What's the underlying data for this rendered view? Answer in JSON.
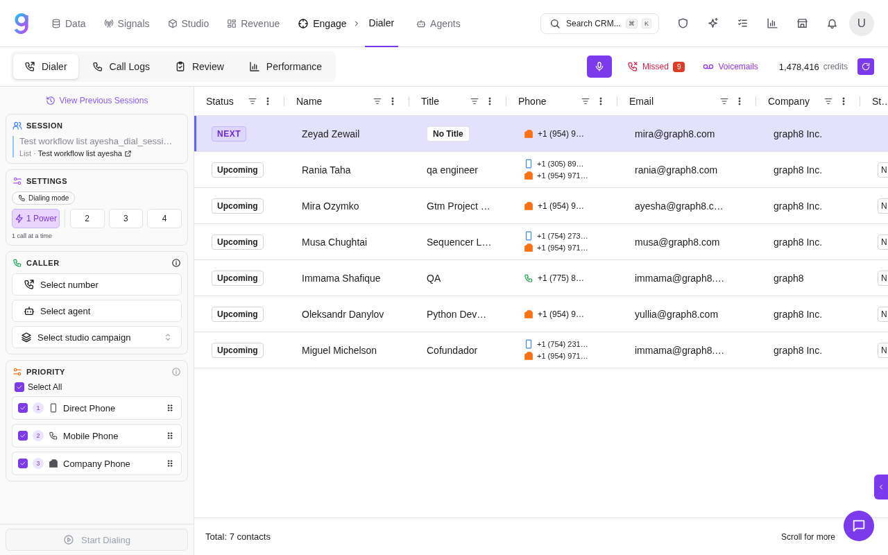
{
  "nav": {
    "items": [
      {
        "label": "Data",
        "selected": false
      },
      {
        "label": "Signals",
        "selected": false
      },
      {
        "label": "Studio",
        "selected": false
      },
      {
        "label": "Revenue",
        "selected": false
      },
      {
        "label": "Engage",
        "sub": "Dialer",
        "selected": true
      },
      {
        "label": "Agents",
        "selected": false
      }
    ]
  },
  "search": {
    "placeholder": "Search CRM...",
    "keys": [
      "⌘",
      "K"
    ]
  },
  "avatar": "U",
  "tabs": [
    {
      "label": "Dialer",
      "selected": true
    },
    {
      "label": "Call Logs",
      "selected": false
    },
    {
      "label": "Review",
      "selected": false
    },
    {
      "label": "Performance",
      "selected": false
    }
  ],
  "missed": {
    "label": "Missed",
    "count": "9"
  },
  "voicemails": "Voicemails",
  "credits": {
    "amount": "1,478,416",
    "unit": "credits"
  },
  "sidebar": {
    "history_link": "View Previous Sessions",
    "session": {
      "heading": "SESSION",
      "name": "Test workflow list ayesha_dial_sessi…",
      "list_label": "List ·",
      "list_name": "Test workflow list ayesha"
    },
    "settings": {
      "heading": "SETTINGS",
      "dialing_mode": "Dialing mode",
      "modes": [
        {
          "label": "1 Power",
          "selected": true
        },
        {
          "label": "2",
          "selected": false
        },
        {
          "label": "3",
          "selected": false
        },
        {
          "label": "4",
          "selected": false
        }
      ],
      "hint": "1 call at a time"
    },
    "caller": {
      "heading": "CALLER",
      "fields": [
        {
          "kind": "number",
          "label": "Select number"
        },
        {
          "kind": "agent",
          "label": "Select agent"
        },
        {
          "kind": "campaign",
          "label": "Select studio campaign"
        }
      ]
    },
    "priority": {
      "heading": "PRIORITY",
      "select_all": {
        "label": "Select All",
        "checked": true
      },
      "items": [
        {
          "rank": "1",
          "kind": "mobile",
          "label": "Direct Phone",
          "checked": true
        },
        {
          "rank": "2",
          "kind": "phone",
          "label": "Mobile Phone",
          "checked": true
        },
        {
          "rank": "3",
          "kind": "company",
          "label": "Company Phone",
          "checked": true
        }
      ]
    },
    "start_button": {
      "label": "Start Dialing",
      "disabled": true
    }
  },
  "table": {
    "columns": [
      "Status",
      "Name",
      "Title",
      "Phone",
      "Email",
      "Company",
      "St…"
    ],
    "rows": [
      {
        "selected": true,
        "status": {
          "label": "NEXT",
          "kind": "next"
        },
        "name": "Zeyad Zewail",
        "title": "No Title",
        "title_missing": true,
        "phones": [
          {
            "kind": "company",
            "number": "+1 (954) 9…"
          }
        ],
        "email": "mira@graph8.com",
        "company": "graph8 Inc."
      },
      {
        "selected": false,
        "status": {
          "label": "Upcoming",
          "kind": "upcoming"
        },
        "name": "Rania Taha",
        "title": "qa engineer",
        "title_missing": false,
        "phones": [
          {
            "kind": "mobile",
            "number": "+1 (305) 89…"
          },
          {
            "kind": "company",
            "number": "+1 (954) 971…"
          }
        ],
        "email": "rania@graph8.com",
        "company": "graph8 Inc.",
        "column_7": "N"
      },
      {
        "selected": false,
        "status": {
          "label": "Upcoming",
          "kind": "upcoming"
        },
        "name": "Mira Ozymko",
        "title": "Gtm Project …",
        "title_missing": false,
        "phones": [
          {
            "kind": "company",
            "number": "+1 (954) 9…"
          }
        ],
        "email": "ayesha@graph8.c…",
        "company": "graph8 Inc.",
        "column_7": "N"
      },
      {
        "selected": false,
        "status": {
          "label": "Upcoming",
          "kind": "upcoming"
        },
        "name": "Musa Chughtai",
        "title": "Sequencer L…",
        "title_missing": false,
        "phones": [
          {
            "kind": "mobile",
            "number": "+1 (754) 273…"
          },
          {
            "kind": "company",
            "number": "+1 (954) 971…"
          }
        ],
        "email": "musa@graph8.com",
        "company": "graph8 Inc.",
        "column_7": "N"
      },
      {
        "selected": false,
        "status": {
          "label": "Upcoming",
          "kind": "upcoming"
        },
        "name": "Immama Shafique",
        "title": "QA",
        "title_missing": false,
        "phones": [
          {
            "kind": "phone",
            "number": "+1 (775) 8…"
          }
        ],
        "email": "immama@graph8.…",
        "company": "graph8",
        "column_7": "N"
      },
      {
        "selected": false,
        "status": {
          "label": "Upcoming",
          "kind": "upcoming"
        },
        "name": "Oleksandr Danylov",
        "title": "Python Dev…",
        "title_missing": false,
        "phones": [
          {
            "kind": "company",
            "number": "+1 (954) 9…"
          }
        ],
        "email": "yullia@graph8.com",
        "company": "graph8 Inc.",
        "column_7": "N"
      },
      {
        "selected": false,
        "status": {
          "label": "Upcoming",
          "kind": "upcoming"
        },
        "name": "Miguel Michelson",
        "title": "Cofundador",
        "title_missing": false,
        "phones": [
          {
            "kind": "mobile",
            "number": "+1 (754) 231…"
          },
          {
            "kind": "company",
            "number": "+1 (954) 971…"
          }
        ],
        "email": "immama@graph8.…",
        "company": "graph8 Inc.",
        "column_7": "N"
      }
    ],
    "footer": {
      "total": "Total: 7 contacts",
      "hint": "Scroll for more"
    }
  }
}
